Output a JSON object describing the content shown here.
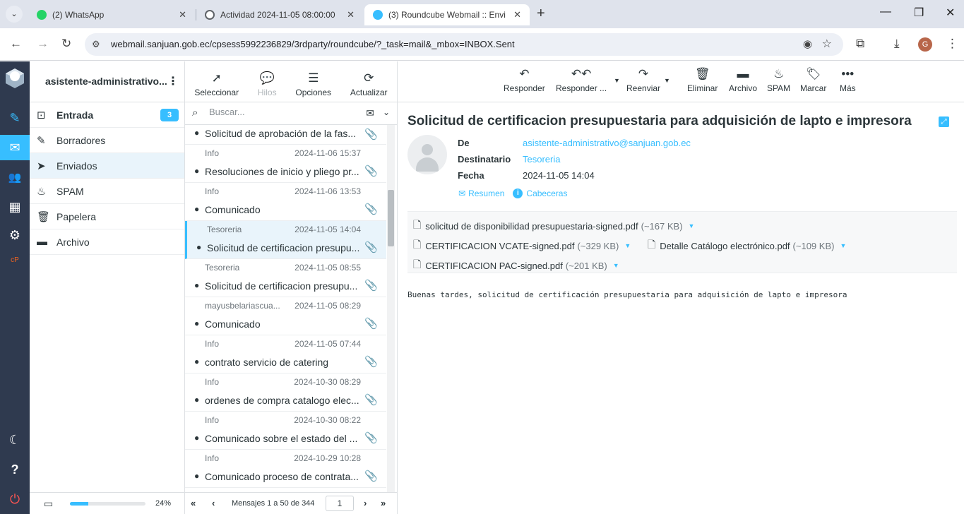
{
  "browser": {
    "tabs": [
      {
        "title": "(2) WhatsApp",
        "favicon_color": "#25d366"
      },
      {
        "title": "Actividad 2024-11-05 08:00:00",
        "favicon_color": "#5f6368"
      },
      {
        "title": "(3) Roundcube Webmail :: Envi",
        "favicon_color": "#37beff",
        "active": true
      }
    ],
    "url_domain": "webmail.sanjuan.gob.ec",
    "url_path": "/cpsess5992236829/3rdparty/roundcube/?_task=mail&_mbox=INBOX.Sent",
    "profile_initial": "G"
  },
  "account_name": "asistente-administrativo...",
  "folders": [
    {
      "name": "Entrada",
      "icon": "inbox-icon",
      "unread": 3
    },
    {
      "name": "Borradores",
      "icon": "pencil-icon"
    },
    {
      "name": "Enviados",
      "icon": "send-icon",
      "selected": true
    },
    {
      "name": "SPAM",
      "icon": "fire-icon"
    },
    {
      "name": "Papelera",
      "icon": "trash-icon"
    },
    {
      "name": "Archivo",
      "icon": "archive-icon"
    }
  ],
  "quota": {
    "percent": 24,
    "label": "24%"
  },
  "list_toolbar": {
    "select": "Seleccionar",
    "threads": "Hilos",
    "options": "Opciones",
    "refresh": "Actualizar"
  },
  "search": {
    "placeholder": "Buscar..."
  },
  "messages": [
    {
      "from": "",
      "date": "",
      "subject": "Solicitud de aprobación de la fas..."
    },
    {
      "from": "Info",
      "date": "2024-11-06 15:37",
      "subject": "Resoluciones de inicio y pliego pr..."
    },
    {
      "from": "Info",
      "date": "2024-11-06 13:53",
      "subject": "Comunicado"
    },
    {
      "from": "Tesoreria",
      "date": "2024-11-05 14:04",
      "subject": "Solicitud de certificacion presupu...",
      "selected": true
    },
    {
      "from": "Tesoreria",
      "date": "2024-11-05 08:55",
      "subject": "Solicitud de certificacion presupu..."
    },
    {
      "from": "mayusbelariascua...",
      "date": "2024-11-05 08:29",
      "subject": "Comunicado"
    },
    {
      "from": "Info",
      "date": "2024-11-05 07:44",
      "subject": "contrato servicio de catering"
    },
    {
      "from": "Info",
      "date": "2024-10-30 08:29",
      "subject": "ordenes de compra catalogo elec..."
    },
    {
      "from": "Info",
      "date": "2024-10-30 08:22",
      "subject": "Comunicado sobre el estado del ..."
    },
    {
      "from": "Info",
      "date": "2024-10-29 10:28",
      "subject": "Comunicado proceso de contrata..."
    }
  ],
  "pager": {
    "label": "Mensajes 1 a 50 de 344",
    "page": "1"
  },
  "read_toolbar": {
    "reply": "Responder",
    "reply_all": "Responder ...",
    "forward": "Reenviar",
    "delete": "Eliminar",
    "archive": "Archivo",
    "spam": "SPAM",
    "mark": "Marcar",
    "more": "Más"
  },
  "mail": {
    "subject": "Solicitud de certificacion presupuestaria para adquisición de lapto e impresora",
    "from_label": "De",
    "from": "asistente-administrativo@sanjuan.gob.ec",
    "to_label": "Destinatario",
    "to": "Tesoreria",
    "date_label": "Fecha",
    "date": "2024-11-05 14:04",
    "summary_link": "Resumen",
    "headers_link": "Cabeceras",
    "attachments": [
      {
        "name": "solicitud de disponibilidad presupuestaria-signed.pdf",
        "size": "(~167 KB)"
      },
      {
        "name": "CERTIFICACION VCATE-signed.pdf",
        "size": "(~329 KB)"
      },
      {
        "name": "Detalle Catálogo electrónico.pdf",
        "size": "(~109 KB)"
      },
      {
        "name": "CERTIFICACION PAC-signed.pdf",
        "size": "(~201 KB)"
      }
    ],
    "body": "Buenas tardes, solicitud de certificación presupuestaria para adquisición de lapto e impresora"
  },
  "colors": {
    "accent": "#37beff",
    "rail": "#2f3a4f",
    "logout": "#ff5552"
  }
}
